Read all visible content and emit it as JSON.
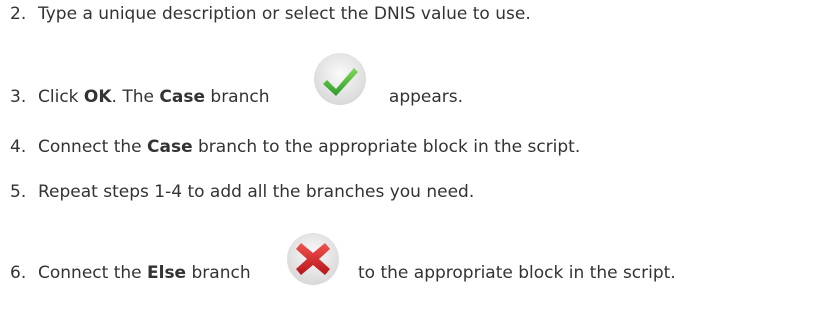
{
  "steps": [
    {
      "number": "2.",
      "text": "Type a unique description or select the DNIS value to use."
    },
    {
      "number": "3.",
      "prefix": "Click ",
      "bold1": "OK",
      "middle": ". The ",
      "bold2": "Case",
      "after": " branch",
      "suffix": " appears.",
      "icon": "green-checkmark-icon"
    },
    {
      "number": "4.",
      "prefix": "Connect the ",
      "bold1": "Case",
      "suffix": " branch to the appropriate block in the script."
    },
    {
      "number": "5.",
      "text": "Repeat steps 1-4 to add all the branches you need."
    },
    {
      "number": "6.",
      "prefix": "Connect the ",
      "bold1": "Else",
      "after": " branch",
      "suffix": " to the appropriate block in the script.",
      "icon": "red-x-icon"
    }
  ],
  "colors": {
    "text": "#333333",
    "check_green": "#3aa832",
    "x_red": "#d6202a",
    "icon_bg": "#e9e9e9"
  }
}
